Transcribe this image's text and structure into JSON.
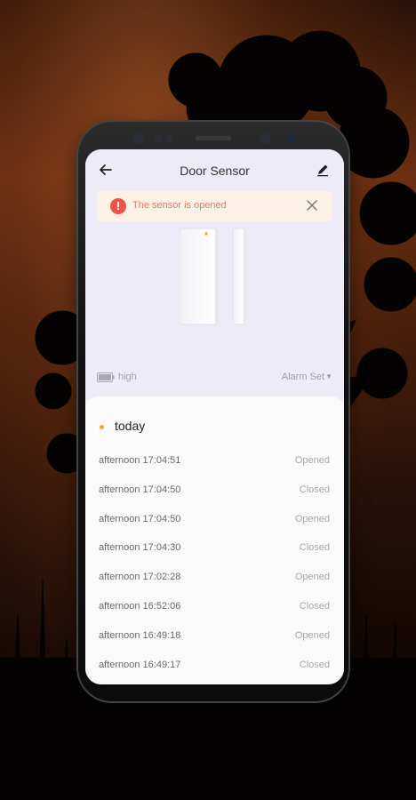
{
  "header": {
    "title": "Door Sensor"
  },
  "alert": {
    "message": "The sensor is opened",
    "color": "#e9534b"
  },
  "status": {
    "battery_label": "high",
    "alarm_label": "Alarm Set"
  },
  "history": {
    "group_label": "today",
    "events": [
      {
        "time": "afternoon  17:04:51",
        "state": "Opened"
      },
      {
        "time": "afternoon  17:04:50",
        "state": "Closed"
      },
      {
        "time": "afternoon  17:04:50",
        "state": "Opened"
      },
      {
        "time": "afternoon  17:04:30",
        "state": "Closed"
      },
      {
        "time": "afternoon  17:02:28",
        "state": "Opened"
      },
      {
        "time": "afternoon  16:52:06",
        "state": "Closed"
      },
      {
        "time": "afternoon  16:49:18",
        "state": "Opened"
      },
      {
        "time": "afternoon  16:49:17",
        "state": "Closed"
      }
    ]
  },
  "icons": [
    "back-arrow-icon",
    "edit-pencil-icon",
    "alert-exclamation-icon",
    "close-icon",
    "battery-icon",
    "dropdown-caret-icon"
  ]
}
